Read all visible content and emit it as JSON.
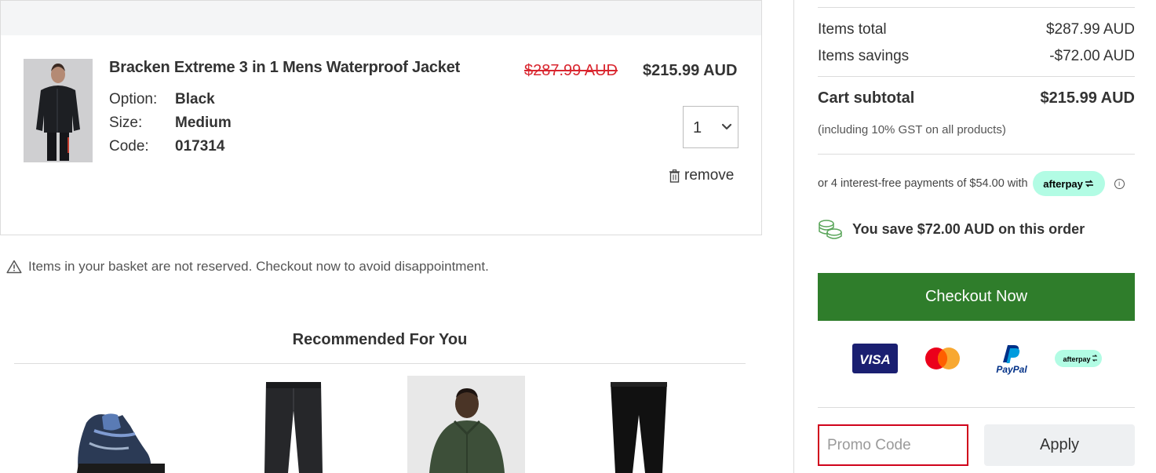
{
  "cart_item": {
    "name": "Bracken Extreme 3 in 1 Mens Waterproof Jacket",
    "attributes": [
      {
        "label": "Option:",
        "value": "Black"
      },
      {
        "label": "Size:",
        "value": "Medium"
      },
      {
        "label": "Code:",
        "value": "017314"
      }
    ],
    "price_original": "$287.99 AUD",
    "price_sale": "$215.99 AUD",
    "quantity": "1",
    "remove_label": "remove",
    "image_icon": "jacket-photo"
  },
  "notice": {
    "icon": "warning-icon",
    "text": "Items in your basket are not reserved. Checkout now to avoid disappointment."
  },
  "recommendations": {
    "title": "Recommended For You",
    "items": [
      {
        "icon": "hiking-boot-photo"
      },
      {
        "icon": "waterproof-trousers-photo"
      },
      {
        "icon": "green-jacket-photo"
      },
      {
        "icon": "black-leggings-photo"
      }
    ]
  },
  "summary": {
    "items_total_label": "Items total",
    "items_total_value": "$287.99 AUD",
    "items_savings_label": "Items savings",
    "items_savings_value": "-$72.00 AUD",
    "cart_subtotal_label": "Cart subtotal",
    "cart_subtotal_value": "$215.99 AUD",
    "gst_note": "(including 10% GST on all products)",
    "afterpay_text": "or 4 interest-free payments of $54.00 with",
    "afterpay_brand": "afterpay",
    "savings_text": "You save $72.00 AUD on this order",
    "checkout_label": "Checkout Now",
    "payment_methods": [
      "VISA",
      "Mastercard",
      "PayPal",
      "afterpay"
    ],
    "promo_placeholder": "Promo Code",
    "apply_label": "Apply"
  },
  "colors": {
    "checkout_green": "#2f7d2b",
    "sale_red": "#d9262f",
    "afterpay_mint": "#b2fce4",
    "promo_border": "#d0021b"
  }
}
